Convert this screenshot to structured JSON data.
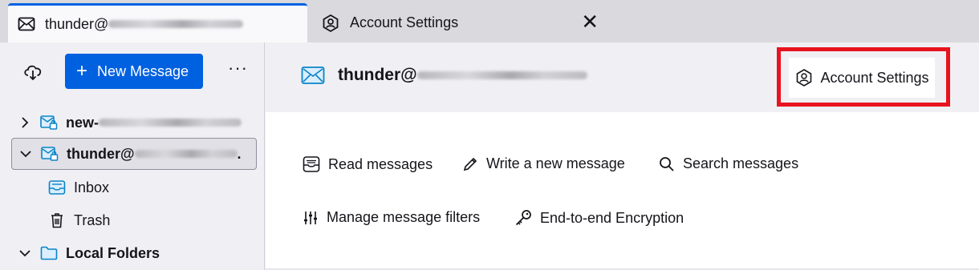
{
  "tabs": [
    {
      "label_prefix": "thunder@",
      "icon": "mail-icon",
      "active": true
    },
    {
      "label": "Account Settings",
      "icon": "account-settings-icon",
      "active": false,
      "close": "✕"
    }
  ],
  "sidebar": {
    "new_message_label": "New Message",
    "more_label": "···",
    "tree": [
      {
        "label_prefix": "new-",
        "expanded": false,
        "icon": "mail-account-icon"
      },
      {
        "label_prefix": "thunder@",
        "label_suffix": ".",
        "expanded": true,
        "selected": true,
        "icon": "mail-account-icon"
      },
      {
        "label": "Inbox",
        "icon": "inbox-icon"
      },
      {
        "label": "Trash",
        "icon": "trash-icon"
      },
      {
        "label": "Local Folders",
        "expanded": true,
        "icon": "folder-icon"
      }
    ]
  },
  "main": {
    "account_title_prefix": "thunder@",
    "account_settings_label": "Account Settings",
    "actions": {
      "read": "Read messages",
      "write": "Write a new message",
      "search": "Search messages",
      "filters": "Manage message filters",
      "e2e": "End-to-end Encryption"
    }
  },
  "colors": {
    "accent": "#0061e0",
    "highlight": "#e8131e"
  }
}
